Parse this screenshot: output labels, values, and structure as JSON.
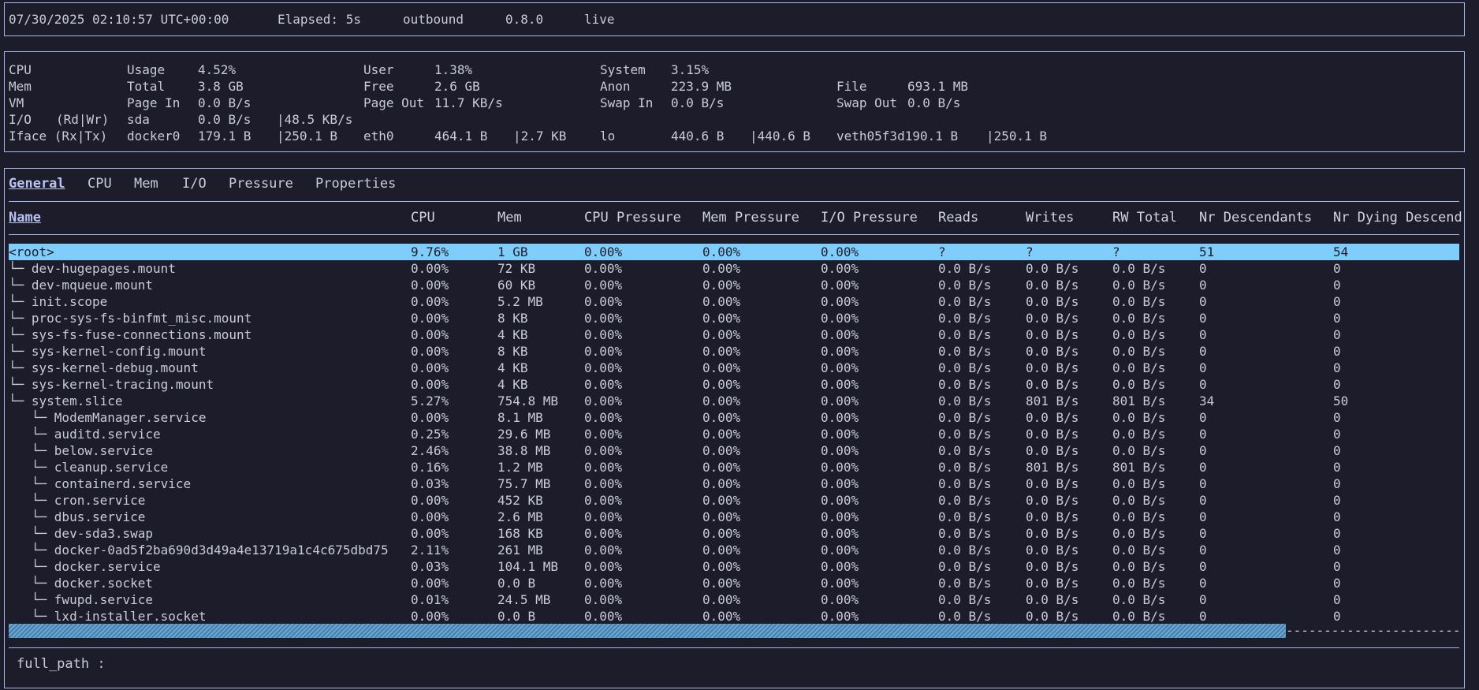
{
  "status": {
    "datetime": "07/30/2025 02:10:57 UTC+00:00",
    "elapsed": "Elapsed: 5s",
    "mode": "outbound",
    "version": "0.8.0",
    "state": "live"
  },
  "summary": {
    "cpu": [
      "CPU",
      "Usage",
      "4.52%",
      "User",
      "1.38%",
      "System",
      "3.15%"
    ],
    "mem": [
      "Mem",
      "Total",
      "3.8 GB",
      "Free",
      "2.6 GB",
      "Anon",
      "223.9 MB",
      "File",
      "693.1 MB"
    ],
    "vm": [
      "VM",
      "Page In",
      "0.0 B/s",
      "Page Out",
      "11.7 KB/s",
      "Swap In",
      "0.0 B/s",
      "Swap Out",
      "0.0 B/s"
    ],
    "io": [
      "I/O",
      "(Rd|Wr)",
      "sda",
      "0.0 B/s",
      "|48.5 KB/s"
    ],
    "iface": [
      "Iface (Rx|Tx)",
      "docker0",
      "179.1 B",
      "|250.1 B",
      "eth0",
      "464.1 B",
      "|2.7 KB",
      "lo",
      "440.6 B",
      "|440.6 B",
      "veth05f3d190.1 B",
      "|250.1 B"
    ]
  },
  "tabs": [
    "General",
    "CPU",
    "Mem",
    "I/O",
    "Pressure",
    "Properties"
  ],
  "columns": [
    "Name",
    "CPU",
    "Mem",
    "CPU Pressure",
    "Mem Pressure",
    "I/O Pressure",
    "Reads",
    "Writes",
    "RW Total",
    "Nr Descendants",
    "Nr Dying Descend"
  ],
  "rows": [
    [
      "<root>",
      "9.76%",
      "1 GB",
      "0.00%",
      "0.00%",
      "0.00%",
      "?",
      "?",
      "?",
      "51",
      "54"
    ],
    [
      "└─ dev-hugepages.mount",
      "0.00%",
      "72 KB",
      "0.00%",
      "0.00%",
      "0.00%",
      "0.0 B/s",
      "0.0 B/s",
      "0.0 B/s",
      "0",
      "0"
    ],
    [
      "└─ dev-mqueue.mount",
      "0.00%",
      "60 KB",
      "0.00%",
      "0.00%",
      "0.00%",
      "0.0 B/s",
      "0.0 B/s",
      "0.0 B/s",
      "0",
      "0"
    ],
    [
      "└─ init.scope",
      "0.00%",
      "5.2 MB",
      "0.00%",
      "0.00%",
      "0.00%",
      "0.0 B/s",
      "0.0 B/s",
      "0.0 B/s",
      "0",
      "0"
    ],
    [
      "└─ proc-sys-fs-binfmt_misc.mount",
      "0.00%",
      "8 KB",
      "0.00%",
      "0.00%",
      "0.00%",
      "0.0 B/s",
      "0.0 B/s",
      "0.0 B/s",
      "0",
      "0"
    ],
    [
      "└─ sys-fs-fuse-connections.mount",
      "0.00%",
      "4 KB",
      "0.00%",
      "0.00%",
      "0.00%",
      "0.0 B/s",
      "0.0 B/s",
      "0.0 B/s",
      "0",
      "0"
    ],
    [
      "└─ sys-kernel-config.mount",
      "0.00%",
      "8 KB",
      "0.00%",
      "0.00%",
      "0.00%",
      "0.0 B/s",
      "0.0 B/s",
      "0.0 B/s",
      "0",
      "0"
    ],
    [
      "└─ sys-kernel-debug.mount",
      "0.00%",
      "4 KB",
      "0.00%",
      "0.00%",
      "0.00%",
      "0.0 B/s",
      "0.0 B/s",
      "0.0 B/s",
      "0",
      "0"
    ],
    [
      "└─ sys-kernel-tracing.mount",
      "0.00%",
      "4 KB",
      "0.00%",
      "0.00%",
      "0.00%",
      "0.0 B/s",
      "0.0 B/s",
      "0.0 B/s",
      "0",
      "0"
    ],
    [
      "└─ system.slice",
      "5.27%",
      "754.8 MB",
      "0.00%",
      "0.00%",
      "0.00%",
      "0.0 B/s",
      "801 B/s",
      "801 B/s",
      "34",
      "50"
    ],
    [
      "   └─ ModemManager.service",
      "0.00%",
      "8.1 MB",
      "0.00%",
      "0.00%",
      "0.00%",
      "0.0 B/s",
      "0.0 B/s",
      "0.0 B/s",
      "0",
      "0"
    ],
    [
      "   └─ auditd.service",
      "0.25%",
      "29.6 MB",
      "0.00%",
      "0.00%",
      "0.00%",
      "0.0 B/s",
      "0.0 B/s",
      "0.0 B/s",
      "0",
      "0"
    ],
    [
      "   └─ below.service",
      "2.46%",
      "38.8 MB",
      "0.00%",
      "0.00%",
      "0.00%",
      "0.0 B/s",
      "0.0 B/s",
      "0.0 B/s",
      "0",
      "0"
    ],
    [
      "   └─ cleanup.service",
      "0.16%",
      "1.2 MB",
      "0.00%",
      "0.00%",
      "0.00%",
      "0.0 B/s",
      "801 B/s",
      "801 B/s",
      "0",
      "0"
    ],
    [
      "   └─ containerd.service",
      "0.03%",
      "75.7 MB",
      "0.00%",
      "0.00%",
      "0.00%",
      "0.0 B/s",
      "0.0 B/s",
      "0.0 B/s",
      "0",
      "0"
    ],
    [
      "   └─ cron.service",
      "0.00%",
      "452 KB",
      "0.00%",
      "0.00%",
      "0.00%",
      "0.0 B/s",
      "0.0 B/s",
      "0.0 B/s",
      "0",
      "0"
    ],
    [
      "   └─ dbus.service",
      "0.00%",
      "2.6 MB",
      "0.00%",
      "0.00%",
      "0.00%",
      "0.0 B/s",
      "0.0 B/s",
      "0.0 B/s",
      "0",
      "0"
    ],
    [
      "   └─ dev-sda3.swap",
      "0.00%",
      "168 KB",
      "0.00%",
      "0.00%",
      "0.00%",
      "0.0 B/s",
      "0.0 B/s",
      "0.0 B/s",
      "0",
      "0"
    ],
    [
      "   └─ docker-0ad5f2ba690d3d49a4e13719a1c4c675dbd75",
      "2.11%",
      "261 MB",
      "0.00%",
      "0.00%",
      "0.00%",
      "0.0 B/s",
      "0.0 B/s",
      "0.0 B/s",
      "0",
      "0"
    ],
    [
      "   └─ docker.service",
      "0.03%",
      "104.1 MB",
      "0.00%",
      "0.00%",
      "0.00%",
      "0.0 B/s",
      "0.0 B/s",
      "0.0 B/s",
      "0",
      "0"
    ],
    [
      "   └─ docker.socket",
      "0.00%",
      "0.0 B",
      "0.00%",
      "0.00%",
      "0.00%",
      "0.0 B/s",
      "0.0 B/s",
      "0.0 B/s",
      "0",
      "0"
    ],
    [
      "   └─ fwupd.service",
      "0.01%",
      "24.5 MB",
      "0.00%",
      "0.00%",
      "0.00%",
      "0.0 B/s",
      "0.0 B/s",
      "0.0 B/s",
      "0",
      "0"
    ],
    [
      "   └─ lxd-installer.socket",
      "0.00%",
      "0.0 B",
      "0.00%",
      "0.00%",
      "0.00%",
      "0.0 B/s",
      "0.0 B/s",
      "0.0 B/s",
      "0",
      "0"
    ]
  ],
  "scrollbar": {
    "rest": "--------------------------------------------------------------------------------------------------------"
  },
  "footer": {
    "label": "full_path :"
  },
  "colors": {
    "background": "#1c1c2a",
    "border": "#aab6ea",
    "selection": "#7ecdfa",
    "text": "#c8ccd8"
  }
}
